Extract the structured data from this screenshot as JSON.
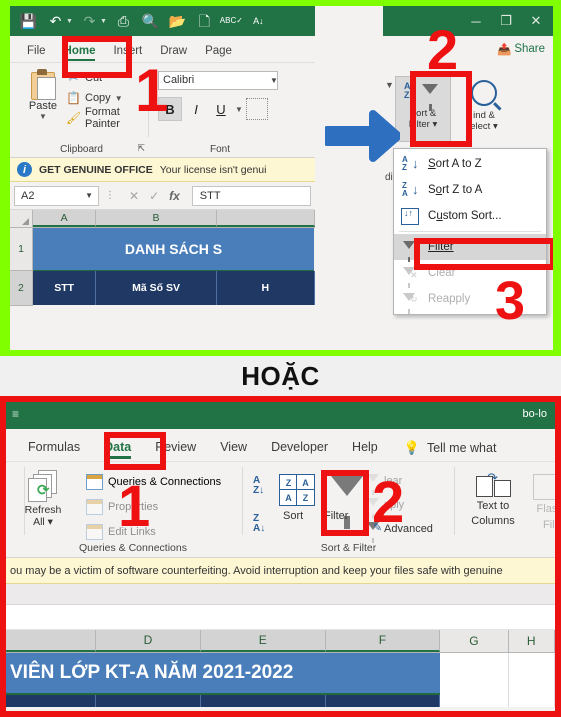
{
  "top_panel": {
    "quick_access": [
      {
        "name": "save-icon",
        "glyph": "ὋE"
      },
      {
        "name": "undo-icon",
        "glyph": "↶"
      },
      {
        "name": "redo-icon",
        "glyph": "↷"
      },
      {
        "name": "quick-print-icon",
        "glyph": "⎙"
      },
      {
        "name": "print-preview-icon",
        "glyph": "ὐD"
      },
      {
        "name": "open-icon",
        "glyph": "Ὄ2"
      },
      {
        "name": "new-icon",
        "glyph": "὜B"
      },
      {
        "name": "spelling-icon",
        "glyph": "ABC"
      },
      {
        "name": "sort-icon",
        "glyph": "A↓"
      }
    ],
    "tabs": [
      {
        "label": "File",
        "active": false
      },
      {
        "label": "Home",
        "active": true
      },
      {
        "label": "Insert",
        "active": false
      },
      {
        "label": "Draw",
        "active": false
      },
      {
        "label": "Page",
        "active": false
      }
    ],
    "clipboard": {
      "paste_label": "Paste",
      "cut_label": "Cut",
      "copy_label": "Copy",
      "format_painter_label": "Format Painter",
      "group_label": "Clipboard"
    },
    "font": {
      "font_name": "Calibri",
      "bold_label": "B",
      "italic_label": "I",
      "underline_label": "U",
      "group_label": "Font"
    },
    "editing": {
      "sort_filter_line1": "Sort &",
      "sort_filter_line2": "Filter",
      "find_line1": "ind &",
      "find_line2": "elect",
      "group_label": "dit"
    },
    "license_bar": {
      "strong": "GET GENUINE OFFICE",
      "text": "Your license isn't genui"
    },
    "formula_bar": {
      "name_box": "A2",
      "cancel_icon": "✕",
      "accept_icon": "✓",
      "fx": "fx",
      "value": "STT"
    },
    "grid": {
      "columns": [
        "A",
        "B"
      ],
      "rows": [
        "1",
        "2"
      ],
      "title_cell": "DANH SÁCH S",
      "header_cells": [
        "STT",
        "Mã Số SV",
        "H"
      ]
    },
    "window_controls": {
      "minimize": "─",
      "restore": "❐",
      "close": "✕"
    },
    "share_label": "Share",
    "dropdown": {
      "items": [
        {
          "label": "Sort A to Z",
          "icon": "sort-ascending-icon",
          "disabled": false,
          "highlighted": false
        },
        {
          "label": "Sort Z to A",
          "icon": "sort-descending-icon",
          "disabled": false,
          "highlighted": false
        },
        {
          "label": "Custom Sort...",
          "icon": "custom-sort-icon",
          "disabled": false,
          "highlighted": false
        },
        {
          "label": "Filter",
          "icon": "filter-icon",
          "disabled": false,
          "highlighted": true
        },
        {
          "label": "Clear",
          "icon": "clear-filter-icon",
          "disabled": true,
          "highlighted": false
        },
        {
          "label": "Reapply",
          "icon": "reapply-filter-icon",
          "disabled": true,
          "highlighted": false
        }
      ]
    },
    "annotations": [
      {
        "number": "1"
      },
      {
        "number": "2"
      },
      {
        "number": "3"
      }
    ]
  },
  "divider": {
    "label": "HOẶC"
  },
  "bottom_panel": {
    "title_bar": {
      "filename": "bo-lo"
    },
    "tabs": [
      {
        "label": "Formulas",
        "active": false
      },
      {
        "label": "Data",
        "active": true
      },
      {
        "label": "Review",
        "active": false
      },
      {
        "label": "View",
        "active": false
      },
      {
        "label": "Developer",
        "active": false
      },
      {
        "label": "Help",
        "active": false
      }
    ],
    "tell_me": "Tell me what",
    "queries_group": {
      "refresh_line1": "Refresh",
      "refresh_line2": "All",
      "queries_connections": "Queries & Connections",
      "properties": "Properties",
      "edit_links": "Edit Links",
      "group_label": "Queries & Connections"
    },
    "sort_filter_group": {
      "sort_label": "Sort",
      "filter_label": "Filter",
      "clear_label": "lear",
      "reapply_label": "pply",
      "advanced_label": "Advanced",
      "group_label": "Sort & Filter"
    },
    "data_tools_group": {
      "text_to_columns_line1": "Text to",
      "text_to_columns_line2": "Columns",
      "flash_fill_line1": "Flash",
      "flash_fill_line2": "Fill"
    },
    "license_bar": {
      "text": "ou may be a victim of software counterfeiting. Avoid interruption and keep your files safe with genuine"
    },
    "grid": {
      "columns": [
        "D",
        "E",
        "F",
        "G",
        "H"
      ],
      "title_cell": "VIÊN LỚP KT-A NĂM 2021-2022"
    },
    "annotations": [
      {
        "number": "1"
      },
      {
        "number": "2"
      }
    ]
  },
  "colors": {
    "green_frame": "#7fff00",
    "red_frame": "#ee1111",
    "excel_green": "#217346",
    "blue_arrow": "#2f6fc0",
    "title_cell_blue": "#4a7ebb",
    "header_navy": "#1f3864",
    "license_yellow": "#fdf7d3"
  }
}
